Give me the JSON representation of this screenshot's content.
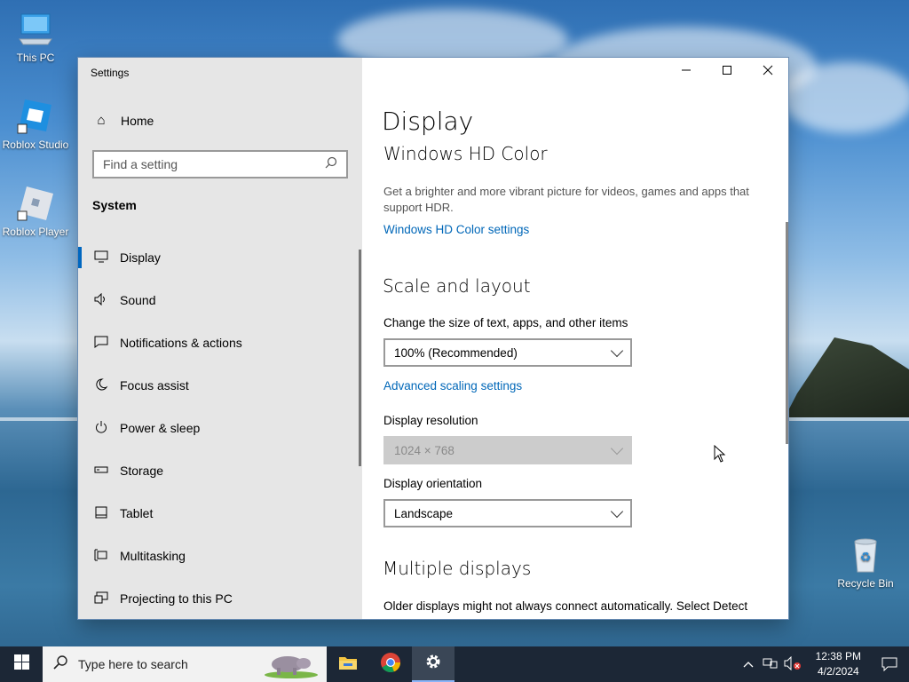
{
  "desktop": {
    "icons": [
      {
        "label": "This PC"
      },
      {
        "label": "Roblox Studio"
      },
      {
        "label": "Roblox Player"
      },
      {
        "label": "Recycle Bin"
      }
    ]
  },
  "window": {
    "title": "Settings",
    "controls": {
      "minimize": "minimize-icon",
      "maximize": "maximize-icon",
      "close": "close-icon"
    }
  },
  "sidebar": {
    "home_label": "Home",
    "search_placeholder": "Find a setting",
    "section_label": "System",
    "items": [
      {
        "label": "Display",
        "icon": "monitor-icon",
        "active": true
      },
      {
        "label": "Sound",
        "icon": "speaker-icon"
      },
      {
        "label": "Notifications & actions",
        "icon": "message-icon"
      },
      {
        "label": "Focus assist",
        "icon": "moon-icon"
      },
      {
        "label": "Power & sleep",
        "icon": "power-icon"
      },
      {
        "label": "Storage",
        "icon": "drive-icon"
      },
      {
        "label": "Tablet",
        "icon": "tablet-icon"
      },
      {
        "label": "Multitasking",
        "icon": "multitasking-icon"
      },
      {
        "label": "Projecting to this PC",
        "icon": "projector-icon"
      }
    ]
  },
  "main": {
    "title": "Display",
    "hdr": {
      "heading": "Windows HD Color",
      "description": "Get a brighter and more vibrant picture for videos, games and apps that support HDR.",
      "link": "Windows HD Color settings"
    },
    "scale": {
      "heading": "Scale and layout",
      "size_label": "Change the size of text, apps, and other items",
      "size_value": "100% (Recommended)",
      "advanced_link": "Advanced scaling settings",
      "resolution_label": "Display resolution",
      "resolution_value": "1024 × 768",
      "orientation_label": "Display orientation",
      "orientation_value": "Landscape"
    },
    "multi": {
      "heading": "Multiple displays",
      "description": "Older displays might not always connect automatically. Select Detect"
    }
  },
  "taskbar": {
    "search_placeholder": "Type here to search",
    "time": "12:38 PM",
    "date": "4/2/2024"
  },
  "colors": {
    "accent": "#0067c0",
    "link": "#0067b8",
    "taskbar": "#1c2736"
  }
}
